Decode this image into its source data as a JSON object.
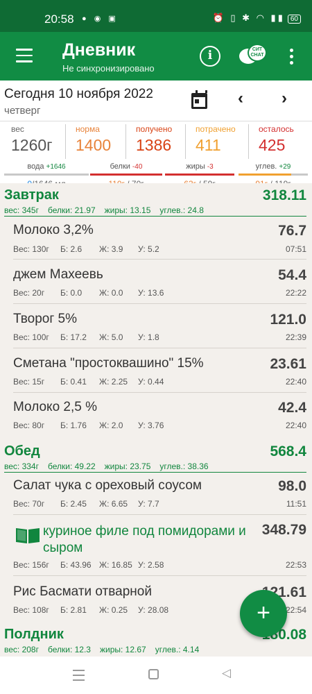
{
  "status": {
    "time": "20:58",
    "battery": "60"
  },
  "appbar": {
    "title": "Дневник",
    "subtitle": "Не синхронизировано",
    "chat_badge": "СИТ СНАТ"
  },
  "date": {
    "label": "Сегодня 10 ноября 2022",
    "weekday": "четверг"
  },
  "summary": {
    "weight_label": "вес",
    "weight": "1260г",
    "norm_label": "норма",
    "norm": "1400",
    "got_label": "получено",
    "got": "1386",
    "spent_label": "потрачено",
    "spent": "411",
    "left_label": "осталось",
    "left": "425",
    "water": {
      "name": "вода",
      "delta": "+1646",
      "value": "0",
      "total": "/1646 мл"
    },
    "protein": {
      "name": "белки",
      "delta": "-40",
      "value": "110г",
      "total": " / 70г"
    },
    "fat": {
      "name": "жиры",
      "delta": "-3",
      "value": "63г",
      "total": " / 59г"
    },
    "carbs": {
      "name": "углев.",
      "delta": "+29",
      "value": "91г",
      "total": " / 119г"
    }
  },
  "colors": {
    "brand": "#118c44",
    "orange": "#e8833a",
    "red": "#d32f2f",
    "blue": "#1e88e5"
  },
  "meals": {
    "breakfast": {
      "name": "Завтрак",
      "total": "318.11",
      "m1": "вес: 345г",
      "m2": "белки: 21.97",
      "m3": "жиры: 13.15",
      "m4": "углев.: 24.8",
      "items": [
        {
          "name": "Молоко 3,2%",
          "kcal": "76.7",
          "w": "Вес: 130г",
          "p": "Б: 2.6",
          "f": "Ж: 3.9",
          "c": "У: 5.2",
          "time": "07:51"
        },
        {
          "name": "джем Махеевь",
          "kcal": "54.4",
          "w": "Вес: 20г",
          "p": "Б: 0.0",
          "f": "Ж: 0.0",
          "c": "У: 13.6",
          "time": "22:22"
        },
        {
          "name": "Творог 5%",
          "kcal": "121.0",
          "w": "Вес: 100г",
          "p": "Б: 17.2",
          "f": "Ж: 5.0",
          "c": "У: 1.8",
          "time": "22:39"
        },
        {
          "name": "Сметана \"простоквашино\" 15%",
          "kcal": "23.61",
          "w": "Вес: 15г",
          "p": "Б: 0.41",
          "f": "Ж: 2.25",
          "c": "У: 0.44",
          "time": "22:40"
        },
        {
          "name": "Молоко 2,5 %",
          "kcal": "42.4",
          "w": "Вес: 80г",
          "p": "Б: 1.76",
          "f": "Ж: 2.0",
          "c": "У: 3.76",
          "time": "22:40"
        }
      ]
    },
    "lunch": {
      "name": "Обед",
      "total": "568.4",
      "m1": "вес: 334г",
      "m2": "белки: 49.22",
      "m3": "жиры: 23.75",
      "m4": "углев.: 38.36",
      "items": [
        {
          "name": "Салат чука с ореховый соусом",
          "kcal": "98.0",
          "w": "Вес: 70г",
          "p": "Б: 2.45",
          "f": "Ж: 6.65",
          "c": "У: 7.7",
          "time": "11:51"
        },
        {
          "name1": "куриное филе под помидорами и",
          "name2": "сыром",
          "kcal": "348.79",
          "w": "Вес: 156г",
          "p": "Б: 43.96",
          "f": "Ж: 16.85",
          "c": "У: 2.58",
          "time": "22:53"
        },
        {
          "name": "Рис Басмати отварной",
          "kcal": "121.61",
          "w": "Вес: 108г",
          "p": "Б: 2.81",
          "f": "Ж: 0.25",
          "c": "У: 28.08",
          "time": "22:54"
        }
      ]
    },
    "snack": {
      "name": "Полдник",
      "total": "180.08",
      "m1": "вес: 208г",
      "m2": "белки: 12.3",
      "m3": "жиры: 12.67",
      "m4": "углев.: 4.14"
    }
  },
  "fab": {
    "label": "+"
  }
}
